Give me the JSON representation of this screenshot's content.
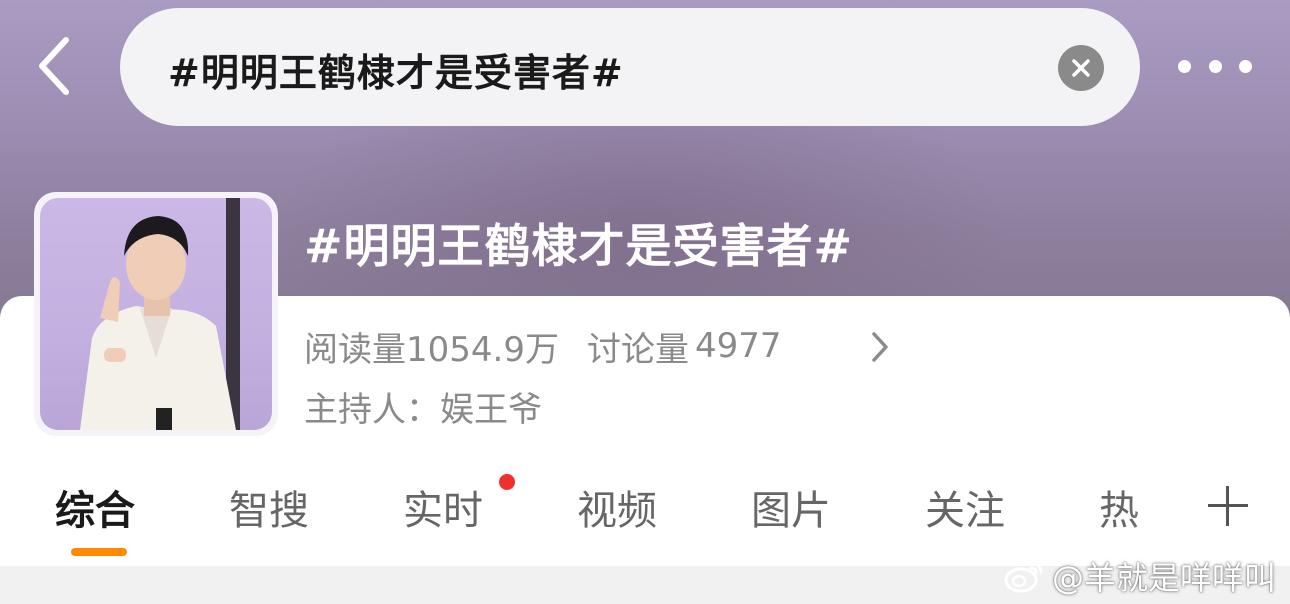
{
  "search": {
    "query": "#明明王鹤棣才是受害者#",
    "clear_icon": "close-circle-icon",
    "back_icon": "chevron-left-icon",
    "more_icon": "more-horizontal-icon"
  },
  "topic": {
    "title": "#明明王鹤棣才是受害者#",
    "reads_label": "阅读量",
    "reads_value": "1054.9万",
    "discussions_label": "讨论量",
    "discussions_value": "4977",
    "host_label": "主持人：",
    "host_name": "娱王爷"
  },
  "tabs": [
    {
      "label": "综合",
      "active": true
    },
    {
      "label": "智搜"
    },
    {
      "label": "实时",
      "badge": "red-dot"
    },
    {
      "label": "视频"
    },
    {
      "label": "图片"
    },
    {
      "label": "关注"
    },
    {
      "label": "热"
    }
  ],
  "colors": {
    "accent": "#ff8a00",
    "badge": "#f0302c",
    "header_bg": "#9d8fb4"
  },
  "watermark": {
    "text": "@羊就是咩咩叫",
    "icon": "weibo-logo-icon"
  }
}
